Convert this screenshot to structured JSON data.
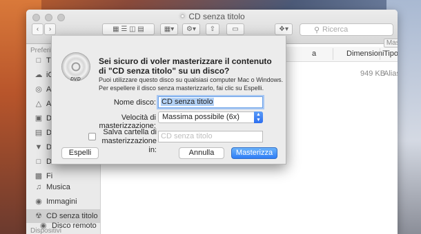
{
  "window": {
    "title": "CD senza titolo",
    "search_placeholder": "Ricerca",
    "burn_label": "Masterizza"
  },
  "sidebar": {
    "favorites_header": "Preferiti",
    "items": [
      {
        "label": "T",
        "icon": "folder-icon"
      },
      {
        "label": "iC",
        "icon": "cloud-icon"
      },
      {
        "label": "A",
        "icon": "airdrop-icon"
      },
      {
        "label": "A",
        "icon": "applications-icon"
      },
      {
        "label": "D",
        "icon": "desktop-icon"
      },
      {
        "label": "D",
        "icon": "documents-icon"
      },
      {
        "label": "D",
        "icon": "downloads-icon"
      },
      {
        "label": "D",
        "icon": "folder-icon"
      },
      {
        "label": "Fi",
        "icon": "movies-icon"
      },
      {
        "label": "Musica",
        "icon": "music-icon"
      },
      {
        "label": "Immagini",
        "icon": "camera-icon"
      },
      {
        "label": "CD senza titolo",
        "icon": "burn-icon"
      }
    ],
    "devices_header": "Dispositivi",
    "device_item": "Disco remoto"
  },
  "table": {
    "col_name": "a",
    "col_size": "Dimensioni",
    "col_kind": "Tipo",
    "row_size": "949 KB",
    "row_kind": "Alias"
  },
  "dialog": {
    "heading": "Sei sicuro di voler masterizzare il contenuto di \"CD senza titolo\" su un disco?",
    "info": "Puoi utilizzare questo disco su qualsiasi computer Mac o Windows. Per espellere il disco senza masterizzarlo, fai clic su Espelli.",
    "disc_name_label": "Nome disco:",
    "disc_name_value": "CD senza titolo",
    "speed_label": "Velocità di masterizzazione:",
    "speed_value": "Massima possibile (6x)",
    "save_label_line1": "Salva cartella di",
    "save_label_line2": "masterizzazione in:",
    "save_placeholder": "CD senza titolo",
    "eject_button": "Espelli",
    "cancel_button": "Annulla",
    "burn_button": "Masterizza",
    "disc_badge": "DVD"
  }
}
